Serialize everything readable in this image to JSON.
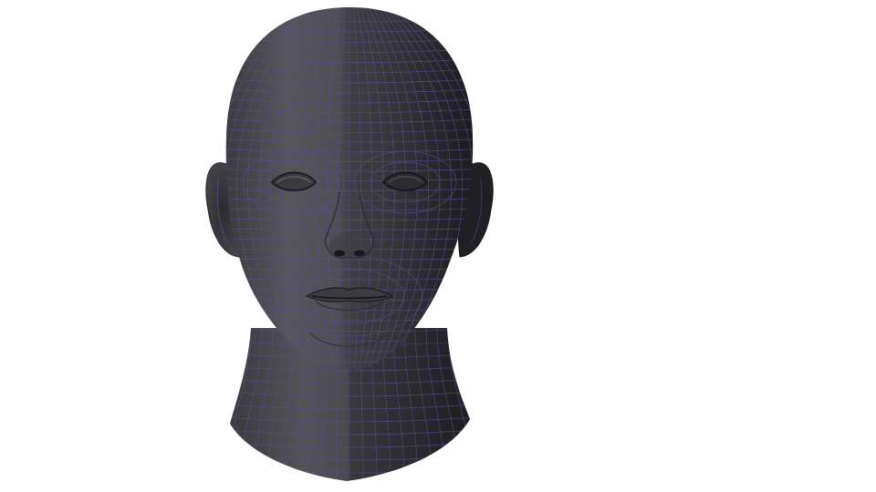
{
  "scene": {
    "background_color": "#ffffff",
    "subject": "head-model-icon",
    "skin_color": "#4a4a4e",
    "wire_color": "#5a4f8f",
    "shading": "left-lit"
  }
}
